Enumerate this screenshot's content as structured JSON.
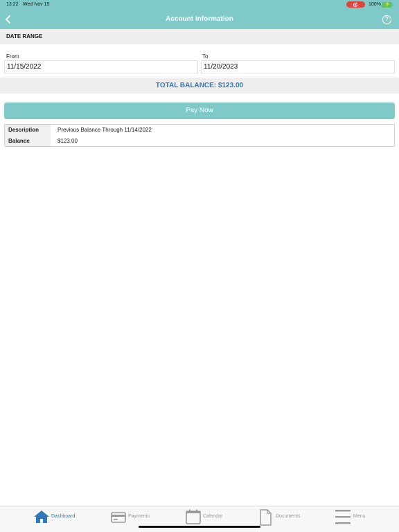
{
  "status_bar": {
    "time": "13:22",
    "date": "Wed Nov 15",
    "battery_percent": "100%"
  },
  "header": {
    "title": "Account Information",
    "back_icon": "chevron-left-icon",
    "help_icon": "question-circle-icon",
    "help_symbol": "?"
  },
  "date_range": {
    "section_title": "DATE RANGE",
    "from_label": "From",
    "from_value": "11/15/2022",
    "to_label": "To",
    "to_value": "11/20/2023"
  },
  "total_balance": "TOTAL BALANCE: $123.00",
  "pay_button_label": "Pay Now",
  "details": [
    {
      "label": "Description",
      "value": "Previous Balance Through 11/14/2022"
    },
    {
      "label": "Balance",
      "value": "$123.00"
    }
  ],
  "tabs": [
    {
      "label": "Dashboard",
      "icon": "home-icon",
      "active": true
    },
    {
      "label": "Payments",
      "icon": "credit-card-icon",
      "active": false
    },
    {
      "label": "Calendar",
      "icon": "calendar-icon",
      "active": false
    },
    {
      "label": "Documents",
      "icon": "document-icon",
      "active": false
    },
    {
      "label": "Menu",
      "icon": "menu-icon",
      "active": false
    }
  ],
  "colors": {
    "header_teal": "#80c9c9",
    "accent_blue": "#3576b6",
    "inactive_gray": "#9a9a9a"
  }
}
